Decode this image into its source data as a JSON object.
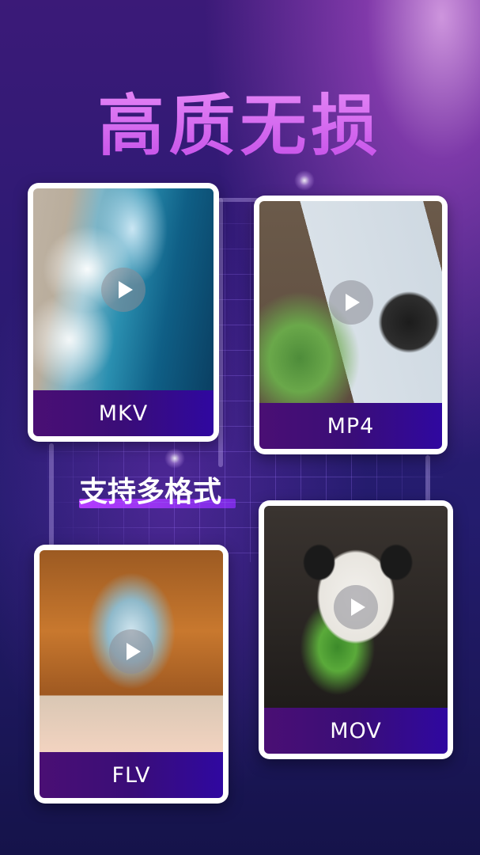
{
  "headline": "高质无损",
  "subtitle": "支持多格式",
  "cards": [
    {
      "label": "MKV",
      "photo": "ocean-waves-aerial"
    },
    {
      "label": "MP4",
      "photo": "map-camera-photos"
    },
    {
      "label": "FLV",
      "photo": "tent-forest-view"
    },
    {
      "label": "MOV",
      "photo": "panda-eating-bamboo"
    }
  ],
  "colors": {
    "accent": "#c44ee8",
    "label_bg": "#3a0d78",
    "background": "#2e1a74"
  },
  "icons": {
    "play": "play-icon"
  }
}
